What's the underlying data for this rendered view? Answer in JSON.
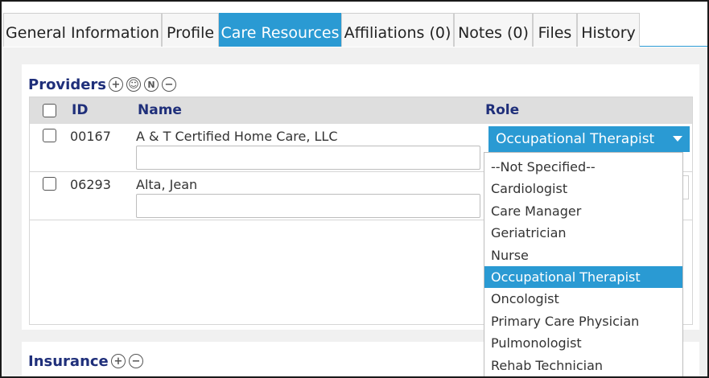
{
  "tabs": [
    {
      "label": "General Information"
    },
    {
      "label": "Profile"
    },
    {
      "label": "Care Resources"
    },
    {
      "label": "Affiliations (0)"
    },
    {
      "label": "Notes (0)"
    },
    {
      "label": "Files"
    },
    {
      "label": "History"
    }
  ],
  "active_tab": "Care Resources",
  "providers": {
    "title": "Providers",
    "icons": [
      "add-icon",
      "add-person-icon",
      "new-icon",
      "remove-icon"
    ],
    "icon_glyphs": {
      "add": "+",
      "person": "☺",
      "new": "N",
      "remove": "−"
    },
    "columns": {
      "id": "ID",
      "name": "Name",
      "role": "Role"
    },
    "rows": [
      {
        "id": "00167",
        "name": "A & T Certified Home Care, LLC",
        "role": "Occupational Therapist",
        "note": ""
      },
      {
        "id": "06293",
        "name": "Alta, Jean",
        "role": "",
        "note": ""
      }
    ]
  },
  "role_dropdown": {
    "selected": "Occupational Therapist",
    "options": [
      "--Not Specified--",
      "Cardiologist",
      "Care Manager",
      "Geriatrician",
      "Nurse",
      "Occupational Therapist",
      "Oncologist",
      "Primary Care Physician",
      "Pulmonologist",
      "Rehab Technician"
    ]
  },
  "insurance": {
    "title": "Insurance",
    "icons": [
      "add-icon",
      "remove-icon"
    ]
  },
  "colors": {
    "accent": "#2a9ad3",
    "heading": "#1f2f7a",
    "background": "#f0f0f0"
  }
}
